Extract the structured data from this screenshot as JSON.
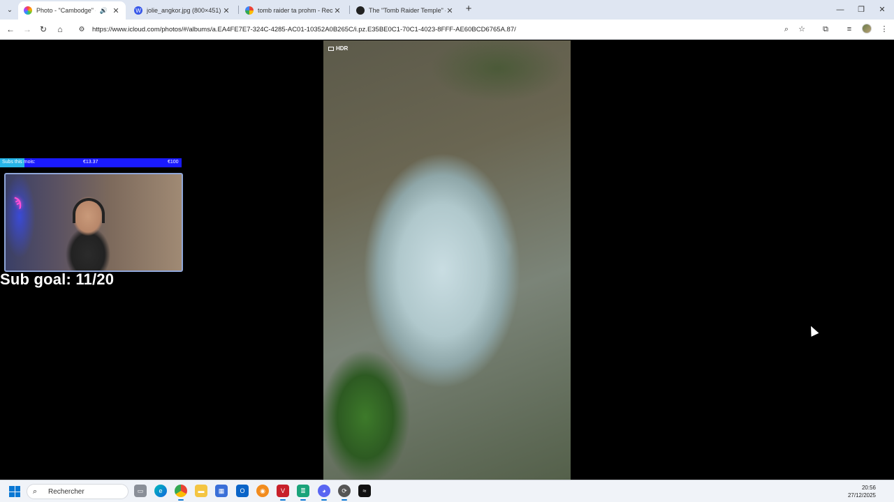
{
  "browser": {
    "tabs": [
      {
        "title": "Photo - \"Cambodge\" - iClou",
        "favicon": "photos-icon",
        "active": true,
        "audio": true
      },
      {
        "title": "jolie_angkor.jpg (800×451)",
        "favicon": "wordpress-icon",
        "active": false
      },
      {
        "title": "tomb raider ta prohm - Recherc",
        "favicon": "google-icon",
        "active": false
      },
      {
        "title": "The \"Tomb Raider Temple\" – Ta",
        "favicon": "site-icon",
        "active": false
      }
    ],
    "url": "https://www.icloud.com/photos/#/albums/a.EA4FE7E7-324C-4285-AC01-10352A0B265C/i.pz.E35BE0C1-70C1-4023-8FFF-AE60BCD6765A.87/"
  },
  "viewer": {
    "badge": "HDR"
  },
  "overlay": {
    "goal_label": "Subs this mois:",
    "goal_current": "€13.37",
    "goal_target": "€100",
    "goal_progress": 0.1337,
    "sub_goal": "Sub goal: 11/20"
  },
  "taskbar": {
    "search_placeholder": "Rechercher",
    "time": "20:56",
    "date": "27/12/2025",
    "apps": [
      "file-explorer-taskview",
      "edge",
      "chrome",
      "file-explorer",
      "store",
      "outlook",
      "app-orange",
      "voice-meeter",
      "app-green",
      "discord",
      "app-sync",
      "terminal"
    ]
  },
  "colors": {
    "tabstrip_bg": "#dfe6f2",
    "goalbar_bg": "#1a1aff",
    "goalbar_fill": "#27b5e8",
    "accent": "#0a78d4"
  }
}
